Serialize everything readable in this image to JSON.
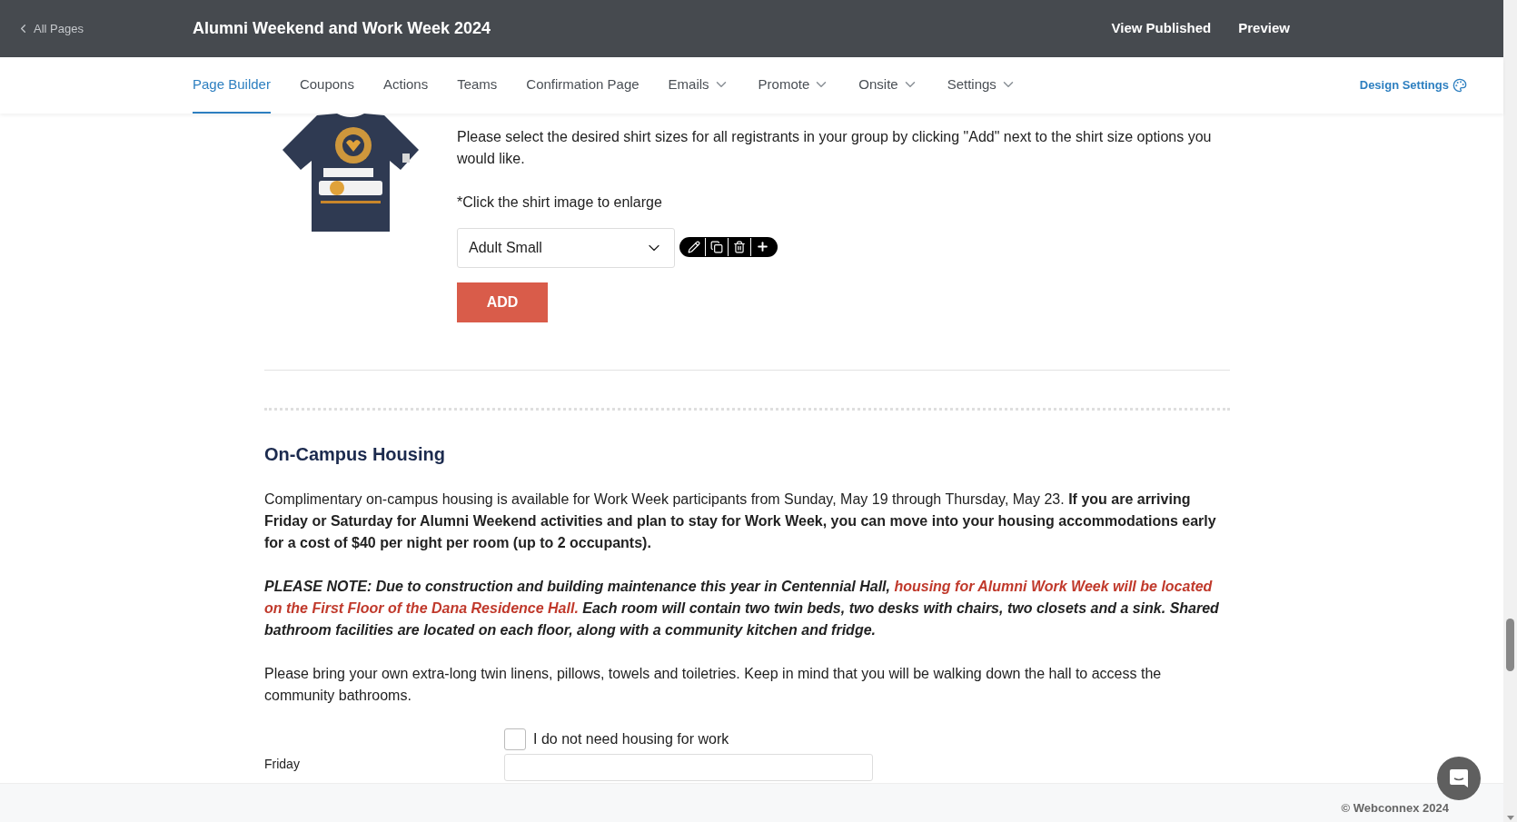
{
  "topbar": {
    "back_link": "All Pages",
    "title": "Alumni Weekend and Work Week 2024",
    "actions": [
      "View Published",
      "Preview"
    ]
  },
  "nav": {
    "tabs": [
      {
        "label": "Page Builder",
        "selected": true,
        "dropdown": false
      },
      {
        "label": "Coupons",
        "selected": false,
        "dropdown": false
      },
      {
        "label": "Actions",
        "selected": false,
        "dropdown": false
      },
      {
        "label": "Teams",
        "selected": false,
        "dropdown": false
      },
      {
        "label": "Confirmation Page",
        "selected": false,
        "dropdown": false
      },
      {
        "label": "Emails",
        "selected": false,
        "dropdown": true
      },
      {
        "label": "Promote",
        "selected": false,
        "dropdown": true
      },
      {
        "label": "Onsite",
        "selected": false,
        "dropdown": true
      },
      {
        "label": "Settings",
        "selected": false,
        "dropdown": true
      }
    ],
    "design_settings": "Design Settings"
  },
  "shirt_section": {
    "description": "Please select the desired shirt sizes for all registrants in your group by clicking \"Add\" next to the shirt size options you would like.",
    "hint": "*Click the shirt image to enlarge",
    "size_select": {
      "value": "Adult Small"
    },
    "add_button": "ADD"
  },
  "housing": {
    "heading": "On-Campus Housing",
    "intro": "Complimentary on-campus housing is available for Work Week participants from Sunday, May 19 through Thursday, May 23. **If you are arriving Friday or Saturday for Alumni Weekend activities and plan to stay for Work Week, you can move into your housing accommodations early for a cost of $40 per night per room (up to 2 occupants).**",
    "note": [
      {
        "kind": "plain",
        "text": "PLEASE NOTE: Due to construction and building maintenance this year in Centennial Hall, "
      },
      {
        "kind": "highlight",
        "text": "housing for Alumni Work Week will be located on the First Floor of the Dana Residence Hall."
      },
      {
        "kind": "plain",
        "text": " Each room will contain two twin beds, two desks with chairs, two closets and a sink. Shared bathroom facilities are located on each floor, along with a community kitchen and fridge."
      }
    ],
    "linens": "Please bring your own extra-long twin linens, pillows, towels and toiletries. Keep in mind that you will be walking down the hall to access the community bathrooms.",
    "no_housing": {
      "label": "I do not need housing for work",
      "checked": false
    },
    "friday": {
      "label": "Friday"
    }
  },
  "footer": {
    "copyright": "© Webconnex 2024"
  }
}
